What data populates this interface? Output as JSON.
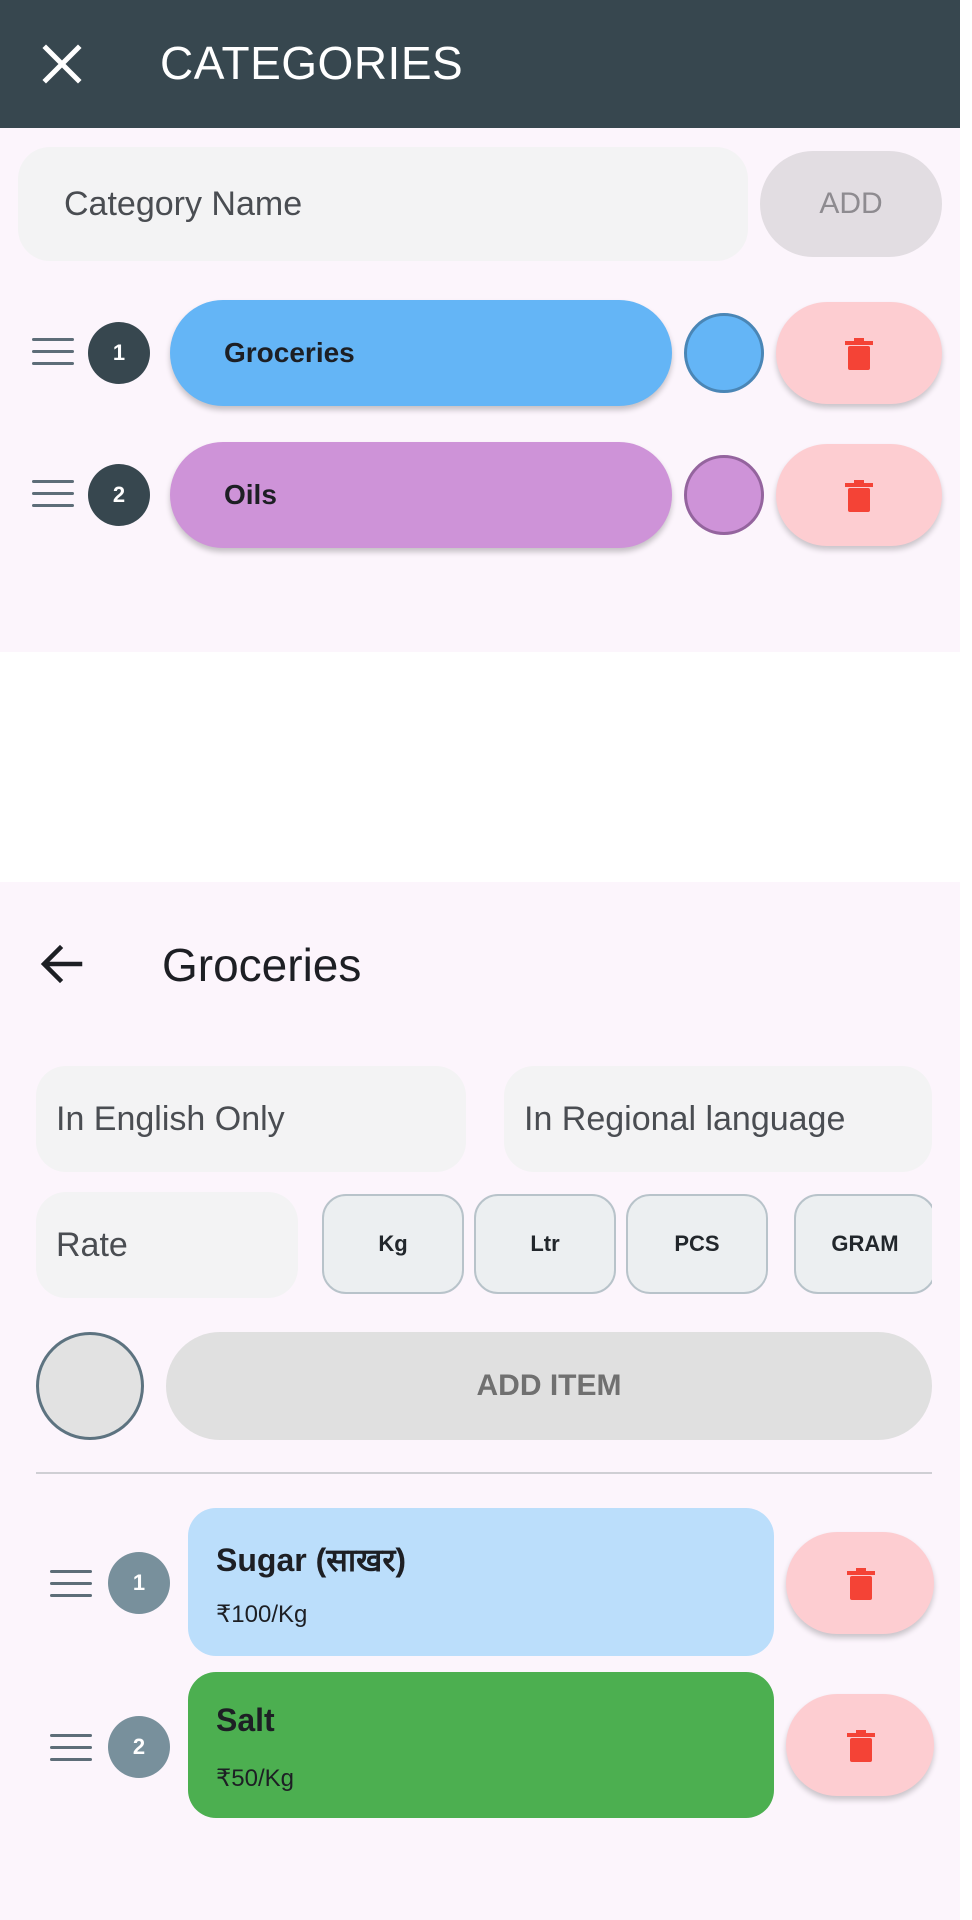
{
  "categories_screen": {
    "title": "CATEGORIES",
    "input_placeholder": "Category Name",
    "add_label": "ADD",
    "items": [
      {
        "index": "1",
        "label": "Groceries",
        "color": "#64b5f6"
      },
      {
        "index": "2",
        "label": "Oils",
        "color": "#ce93d8"
      }
    ]
  },
  "items_screen": {
    "title": "Groceries",
    "english_placeholder": "In English Only",
    "regional_placeholder": "In Regional language",
    "rate_placeholder": "Rate",
    "units": [
      "Kg",
      "Ltr",
      "PCS",
      "GRAM"
    ],
    "add_item_label": "ADD ITEM",
    "items": [
      {
        "index": "1",
        "name": "Sugar (साखर)",
        "rate": "₹100/Kg",
        "color": "#bbdefb"
      },
      {
        "index": "2",
        "name": "Salt",
        "rate": "₹50/Kg",
        "color": "#4caf50"
      }
    ]
  },
  "colors": {
    "appbar": "#37474f",
    "delete_bg": "#fdcdd1",
    "delete_icon": "#f44336"
  },
  "icons": [
    "close-icon",
    "drag-handle-icon",
    "delete-icon",
    "back-arrow-icon"
  ]
}
